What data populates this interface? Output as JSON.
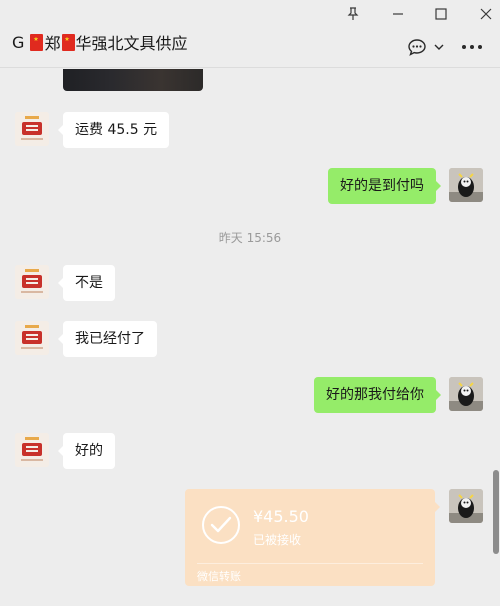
{
  "window": {
    "title_parts": [
      "G ",
      "郑",
      "华强北文具供应"
    ],
    "controls": [
      "pin-icon",
      "minimize-icon",
      "maximize-icon",
      "close-icon"
    ]
  },
  "header": {
    "actions": [
      "chat-bubble-icon",
      "chevron-down-icon",
      "more-icon"
    ]
  },
  "messages": [
    {
      "side": "left",
      "text": "运费 45.5 元"
    },
    {
      "side": "right",
      "text": "好的是到付吗"
    },
    {
      "side": "left",
      "text": "不是"
    },
    {
      "side": "left",
      "text": "我已经付了"
    },
    {
      "side": "right",
      "text": "好的那我付给你"
    },
    {
      "side": "left",
      "text": "好的"
    }
  ],
  "timestamp": "昨天 15:56",
  "transfer": {
    "amount": "¥45.50",
    "status": "已被接收",
    "footer": "微信转账"
  },
  "colors": {
    "background": "#ededed",
    "bubble_self": "#95ec69",
    "bubble_other": "#ffffff",
    "transfer": "#fbe0c3"
  }
}
